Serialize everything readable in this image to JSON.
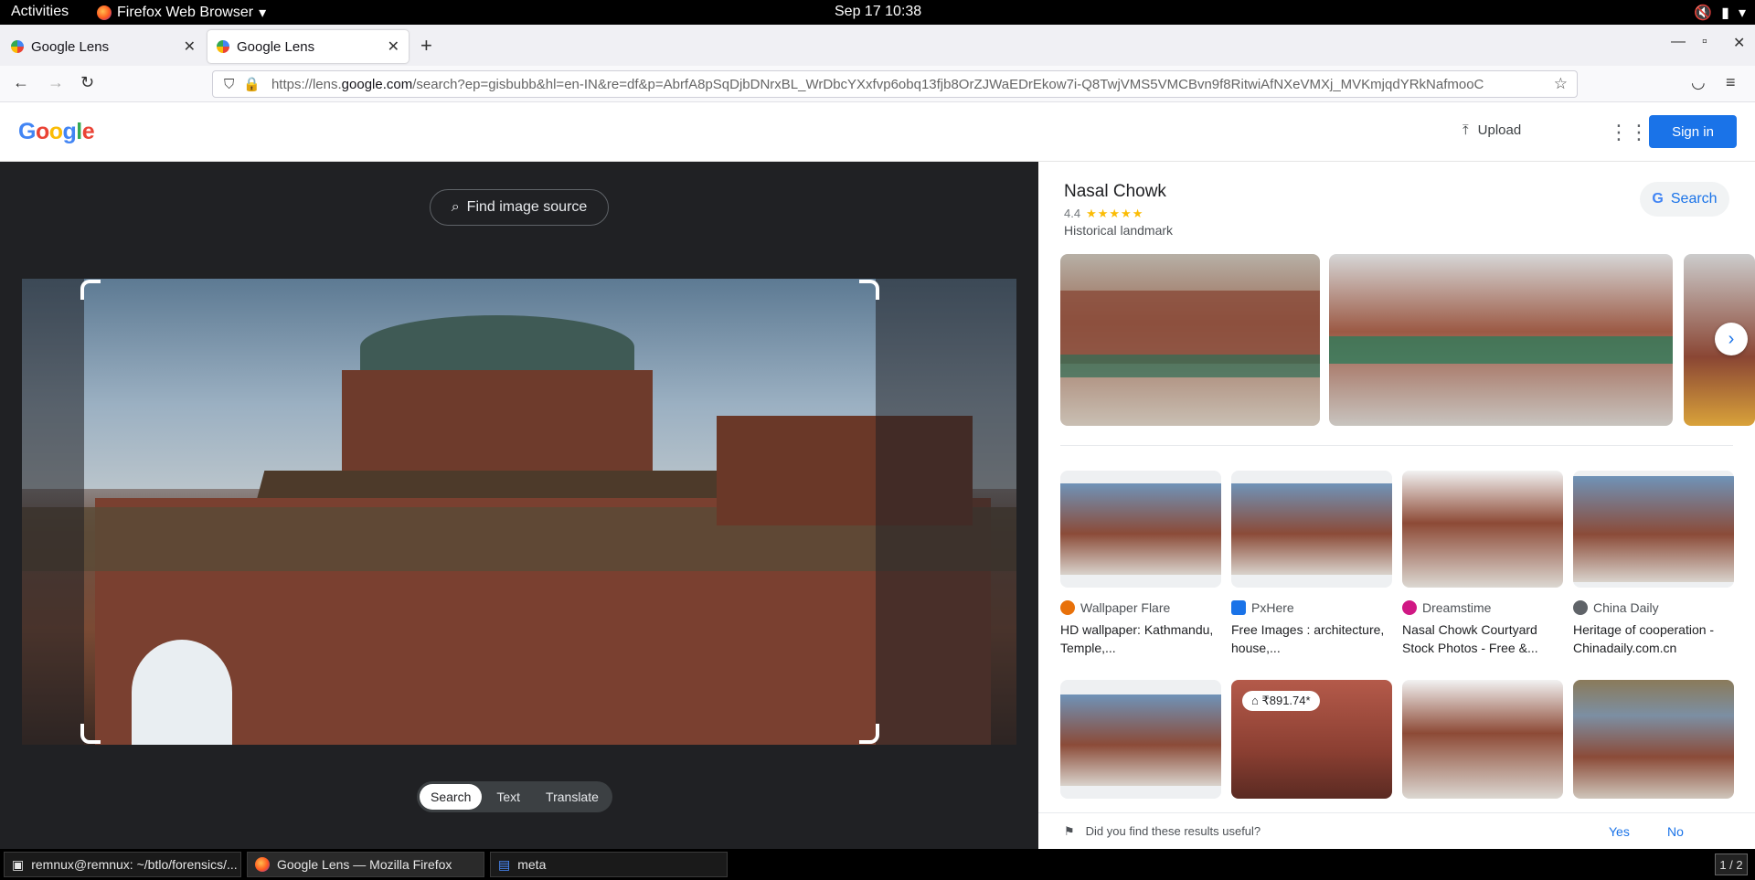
{
  "topbar": {
    "activities": "Activities",
    "app_name": "Firefox Web Browser",
    "clock": "Sep 17  10:38"
  },
  "tabs": [
    {
      "title": "Google Lens"
    },
    {
      "title": "Google Lens"
    }
  ],
  "urlbar": {
    "prefix": "https://lens.",
    "domain": "google.com",
    "rest": "/search?ep=gisbubb&hl=en-IN&re=df&p=AbrfA8pSqDjbDNrxBL_WrDbcYXxfvp6obq13fjb8OrZJWaEDrEkow7i-Q8TwjVMS5VMCBvn9f8RitwiAfNXeVMXj_MVKmjqdYRkNafmooC"
  },
  "google_header": {
    "logo_letters": [
      "G",
      "o",
      "o",
      "g",
      "l",
      "e"
    ],
    "upload_label": "Upload",
    "signin_label": "Sign in"
  },
  "viewer": {
    "find_source_label": "Find image source",
    "modes": [
      "Search",
      "Text",
      "Translate"
    ],
    "selected_mode": "Search"
  },
  "knowledge_panel": {
    "title": "Nasal Chowk",
    "rating": "4.4",
    "stars": "★★★★★",
    "type": "Historical landmark",
    "search_label": "Search"
  },
  "results": [
    {
      "source": "Wallpaper Flare",
      "title": "HD wallpaper: Kathmandu, Temple,...",
      "fav_color": "#e8710a"
    },
    {
      "source": "PxHere",
      "title": "Free Images : architecture, house,...",
      "fav_color": "#1a73e8",
      "fav_text": "ph"
    },
    {
      "source": "Dreamstime",
      "title": "Nasal Chowk Courtyard Stock Photos - Free &...",
      "fav_color": "#d01884"
    },
    {
      "source": "China Daily",
      "title": "Heritage of cooperation - Chinadaily.com.cn",
      "fav_color": "#5f6368"
    }
  ],
  "price_badge": "₹891.74*",
  "feedback": {
    "question": "Did you find these results useful?",
    "yes": "Yes",
    "no": "No"
  },
  "taskbar": [
    {
      "label": "remnux@remnux: ~/btlo/forensics/..."
    },
    {
      "label": "Google Lens — Mozilla Firefox"
    },
    {
      "label": "meta"
    }
  ],
  "pager": "1 / 2"
}
